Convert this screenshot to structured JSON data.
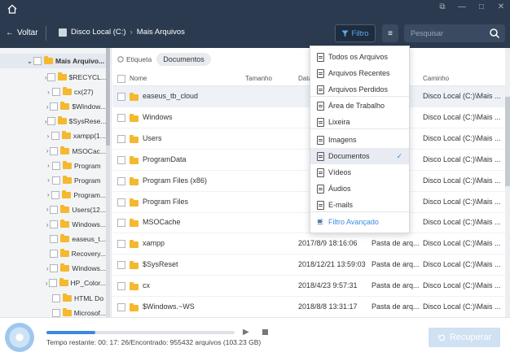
{
  "window": {
    "controls": [
      "⧉",
      "—",
      "□",
      "✕"
    ]
  },
  "toolbar": {
    "back_label": "Voltar",
    "breadcrumb": [
      "Disco Local (C:)",
      "Mais Arquivos"
    ],
    "filter_label": "Filtro",
    "search_placeholder": "Pesquisar",
    "accent": "#5aa9f5"
  },
  "sidebar": {
    "root": "Mais Arquivo...",
    "items": [
      {
        "label": "$RECYCL...",
        "expandable": true
      },
      {
        "label": "cx(27)",
        "expandable": true
      },
      {
        "label": "$Window...",
        "expandable": true
      },
      {
        "label": "$SysRese...",
        "expandable": true
      },
      {
        "label": "xampp(1...",
        "expandable": true
      },
      {
        "label": "MSOCac...",
        "expandable": true
      },
      {
        "label": "Program",
        "expandable": true
      },
      {
        "label": "Program",
        "expandable": true
      },
      {
        "label": "Program...",
        "expandable": true
      },
      {
        "label": "Users(12...",
        "expandable": true
      },
      {
        "label": "Windows...",
        "expandable": true
      },
      {
        "label": "easeus_t...",
        "expandable": false
      },
      {
        "label": "Recovery...",
        "expandable": false
      },
      {
        "label": "Windows...",
        "expandable": true
      },
      {
        "label": "HP_Color...",
        "expandable": true
      },
      {
        "label": "HTML Do",
        "expandable": false
      },
      {
        "label": "Microsof...",
        "expandable": false
      }
    ]
  },
  "tags": {
    "label": "Etiqueta",
    "active": "Documentos"
  },
  "table": {
    "columns": {
      "name": "Nome",
      "size": "Tamanho",
      "date": "Data",
      "path": "Caminho"
    },
    "rows": [
      {
        "name": "easeus_tb_cloud",
        "date": "",
        "type": "",
        "path": "Disco Local (C:)\\Mais ..."
      },
      {
        "name": "Windows",
        "date": "",
        "type": "",
        "path": "Disco Local (C:)\\Mais ..."
      },
      {
        "name": "Users",
        "date": "",
        "type": "",
        "path": "Disco Local (C:)\\Mais ..."
      },
      {
        "name": "ProgramData",
        "date": "",
        "type": "",
        "path": "Disco Local (C:)\\Mais ..."
      },
      {
        "name": "Program Files (x86)",
        "date": "",
        "type": "",
        "path": "Disco Local (C:)\\Mais ..."
      },
      {
        "name": "Program Files",
        "date": "",
        "type": "",
        "path": "Disco Local (C:)\\Mais ..."
      },
      {
        "name": "MSOCache",
        "date": "",
        "type": "",
        "path": "Disco Local (C:)\\Mais ..."
      },
      {
        "name": "xampp",
        "date": "2017/8/9 18:16:06",
        "type": "Pasta de arq...",
        "path": "Disco Local (C:)\\Mais ..."
      },
      {
        "name": "$SysReset",
        "date": "2018/12/21 13:59:03",
        "type": "Pasta de arq...",
        "path": "Disco Local (C:)\\Mais ..."
      },
      {
        "name": "cx",
        "date": "2018/4/23 9:57:31",
        "type": "Pasta de arq...",
        "path": "Disco Local (C:)\\Mais ..."
      },
      {
        "name": "$Windows.~WS",
        "date": "2018/8/8 13:31:17",
        "type": "Pasta de arq...",
        "path": "Disco Local (C:)\\Mais ..."
      }
    ]
  },
  "filter_menu": {
    "items": [
      {
        "label": "Todos os Arquivos"
      },
      {
        "label": "Arquivos Recentes"
      },
      {
        "label": "Arquivos Perdidos"
      },
      {
        "label": "Área de Trabalho"
      },
      {
        "label": "Lixeira"
      },
      {
        "label": "Imagens"
      },
      {
        "label": "Documentos",
        "selected": true
      },
      {
        "label": "Vídeos"
      },
      {
        "label": "Áudios"
      },
      {
        "label": "E-mails"
      }
    ],
    "check": "✓",
    "advanced": "Filtro Avançado"
  },
  "scan": {
    "progress_fraction": 0.26,
    "status": "Tempo restante: 00: 17: 26/Encontrado: 955432 arquivos (103.23 GB)",
    "recover_label": "Recuperar"
  }
}
